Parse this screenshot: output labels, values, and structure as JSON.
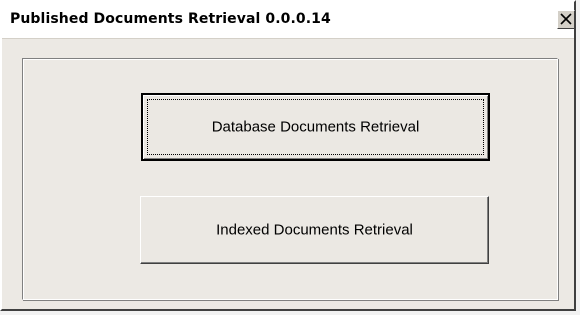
{
  "window": {
    "title": "Published Documents Retrieval 0.0.0.14"
  },
  "titlebar": {
    "close_icon": "close-icon"
  },
  "buttons": {
    "database_label": "Database Documents Retrieval",
    "indexed_label": "Indexed Documents Retrieval"
  }
}
